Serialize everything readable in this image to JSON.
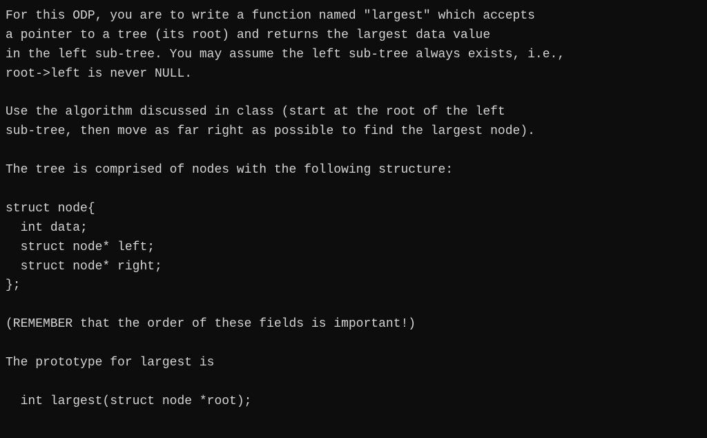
{
  "content": {
    "lines": [
      "For this ODP, you are to write a function named \"largest\" which accepts",
      "a pointer to a tree (its root) and returns the largest data value",
      "in the left sub-tree. You may assume the left sub-tree always exists, i.e.,",
      "root->left is never NULL.",
      "",
      "Use the algorithm discussed in class (start at the root of the left",
      "sub-tree, then move as far right as possible to find the largest node).",
      "",
      "The tree is comprised of nodes with the following structure:",
      "",
      "struct node{",
      "  int data;",
      "  struct node* left;",
      "  struct node* right;",
      "};",
      "",
      "(REMEMBER that the order of these fields is important!)",
      "",
      "The prototype for largest is",
      "",
      "  int largest(struct node *root);"
    ]
  }
}
